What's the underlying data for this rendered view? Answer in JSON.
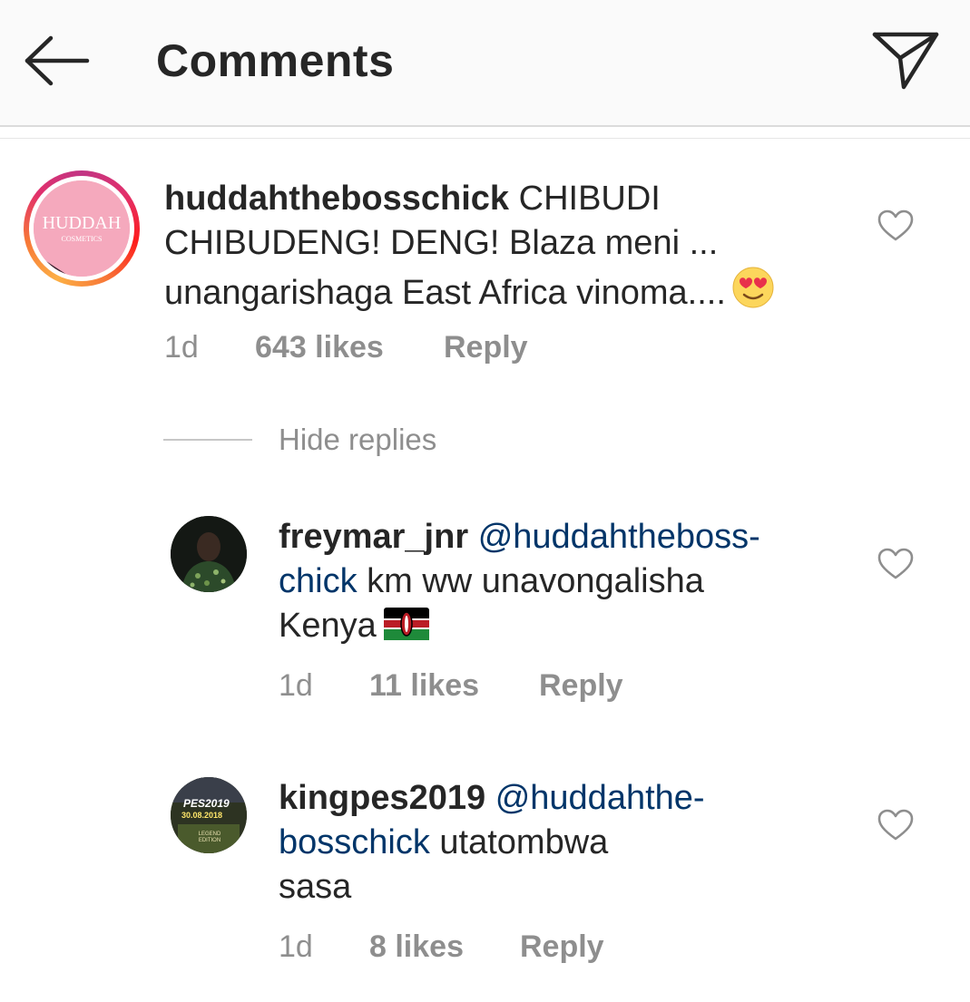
{
  "header": {
    "title": "Comments",
    "back_icon": "arrow-left-icon",
    "send_icon": "paper-plane-icon"
  },
  "comments": [
    {
      "username": "huddahthebosschick",
      "text": "CHIBUDI CHIBUDENG! DENG! Blaza meni ... unangarishaga East Africa vinoma....",
      "emoji": "heart-eyes-emoji",
      "avatar_logo": "HUDDAH",
      "avatar_sub": "COSMETICS",
      "time": "1d",
      "likes": "643 likes",
      "reply": "Reply"
    }
  ],
  "hide_replies": "Hide replies",
  "replies": [
    {
      "username": "freymar_jnr",
      "mention_part1": "@huddahtheboss-",
      "mention_part2": "chick",
      "text_line2": " km ww unavongalisha",
      "text_line3": "Kenya",
      "emoji": "kenya-flag-emoji",
      "time": "1d",
      "likes": "11 likes",
      "reply": "Reply"
    },
    {
      "username": "kingpes2019",
      "mention_part1": "@huddahthe-",
      "mention_part2": "bosschick",
      "text_line2": " utatombwa",
      "text_line3": "sasa",
      "avatar_text": "PES2019",
      "avatar_date": "30.08.2018",
      "avatar_edition": "LEGEND EDITION",
      "time": "1d",
      "likes": "8 likes",
      "reply": "Reply"
    }
  ],
  "colors": {
    "mention": "#003569",
    "meta": "#8e8e8e",
    "header_bg": "#fafafa"
  }
}
